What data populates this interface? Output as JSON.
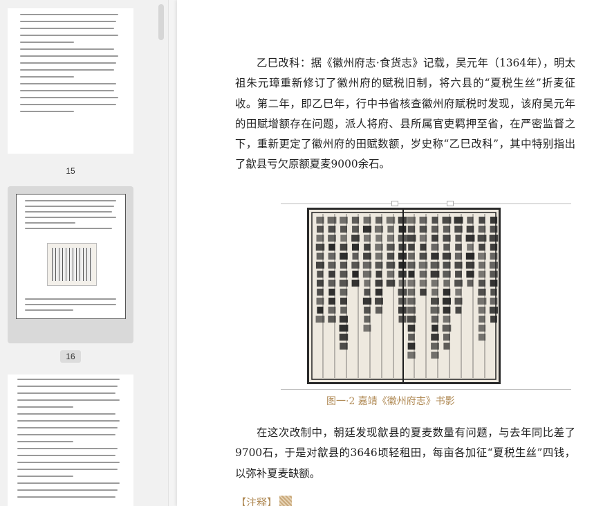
{
  "sidebar": {
    "pages": [
      {
        "number": "15",
        "selected": false
      },
      {
        "number": "16",
        "selected": true
      },
      {
        "number": "",
        "selected": false
      }
    ]
  },
  "document": {
    "paragraph1": "乙巳改科：据《徽州府志·食货志》记载，吴元年（1364年），明太祖朱元璋重新修订了徽州府的赋税旧制，将六县的“夏税生丝”折麦征收。第二年，即乙巳年，行中书省核查徽州府赋税时发现，该府吴元年的田赋增额存在问题，派人将府、县所属官吏羁押至省，在严密监督之下，重新更定了徽州府的田赋数额，岁史称“乙巳改科”，其中特别指出了歙县亏欠原额夏麦9000余石。",
    "figure_caption": "图一·2 嘉靖《徽州府志》书影",
    "paragraph2": "在这次改制中，朝廷发现歙县的夏麦数量有问题，与去年同比差了9700石，于是对歙县的3646顷轻租田，每亩各加征“夏税生丝”四钱，以弥补夏麦缺额。",
    "note_label": "【注释】"
  },
  "colors": {
    "caption": "#b08a55",
    "selected_thumb_bg": "#d9d9d9"
  }
}
